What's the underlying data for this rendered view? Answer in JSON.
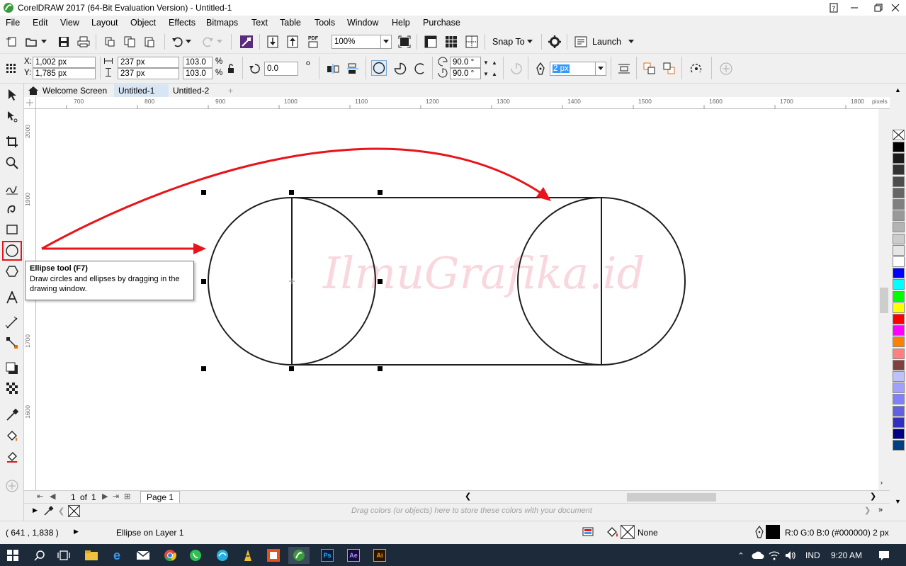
{
  "app": {
    "title": "CorelDRAW 2017 (64-Bit Evaluation Version) - Untitled-1"
  },
  "menu": [
    "File",
    "Edit",
    "View",
    "Layout",
    "Object",
    "Effects",
    "Bitmaps",
    "Text",
    "Table",
    "Tools",
    "Window",
    "Help",
    "Purchase"
  ],
  "toolbar": {
    "zoom": "100%",
    "snap_label": "Snap To",
    "launch_label": "Launch",
    "pdf_label": "PDF"
  },
  "propertybar": {
    "x_label": "X:",
    "x_value": "1,002 px",
    "y_label": "Y:",
    "y_value": "1,785 px",
    "width_value": "237 px",
    "height_value": "237 px",
    "scale_x": "103.0",
    "scale_y": "103.0",
    "percent": "%",
    "rotation": "0.0",
    "degree": "o",
    "start_angle": "90.0 °",
    "end_angle": "90.0 °",
    "outline_width": "2 px"
  },
  "tabs": {
    "welcome": "Welcome Screen",
    "doc1": "Untitled-1",
    "doc2": "Untitled-2",
    "add": "+"
  },
  "ruler": {
    "h_ticks": [
      "700",
      "800",
      "900",
      "1000",
      "1100",
      "1200",
      "1300",
      "1400",
      "1500",
      "1600",
      "1700",
      "1800"
    ],
    "h_unit": "pixels",
    "v_ticks": [
      "2000",
      "1900",
      "1800",
      "1700",
      "1600"
    ]
  },
  "tooltip": {
    "title": "Ellipse tool (F7)",
    "body": "Draw circles and ellipses by dragging in the drawing window."
  },
  "watermark": "IlmuGrafika.id",
  "pagebar": {
    "current": "1",
    "of": "of",
    "total": "1",
    "page_tab": "Page 1"
  },
  "docpalette": {
    "hint": "Drag colors (or objects) here to store these colors with your document"
  },
  "status": {
    "coords": "( 641  , 1,838  )",
    "object_info": "Ellipse on Layer 1",
    "fill_label": "None",
    "outline_info": "R:0 G:0 B:0 (#000000)  2 px"
  },
  "taskbar": {
    "lang": "IND",
    "time": "9:20 AM",
    "ps_label": "Ps",
    "ae_label": "Ae",
    "ai_label": "Ai"
  },
  "colors": {
    "accent_red": "#e8141a",
    "taskbar": "#1c2a3a",
    "selection_blue": "#3399ff"
  },
  "palette": [
    "#000000",
    "#1a1a1a",
    "#333333",
    "#4d4d4d",
    "#666666",
    "#808080",
    "#999999",
    "#b3b3b3",
    "#cccccc",
    "#e6e6e6",
    "#ffffff",
    "#0000ff",
    "#00ffff",
    "#00ff00",
    "#ffff00",
    "#ff0000",
    "#ff00ff",
    "#ff8000",
    "#ff8080",
    "#804040",
    "#c0c0ff",
    "#a0a0ff",
    "#8080ff",
    "#6060e0",
    "#3030c0",
    "#000080",
    "#004080"
  ]
}
